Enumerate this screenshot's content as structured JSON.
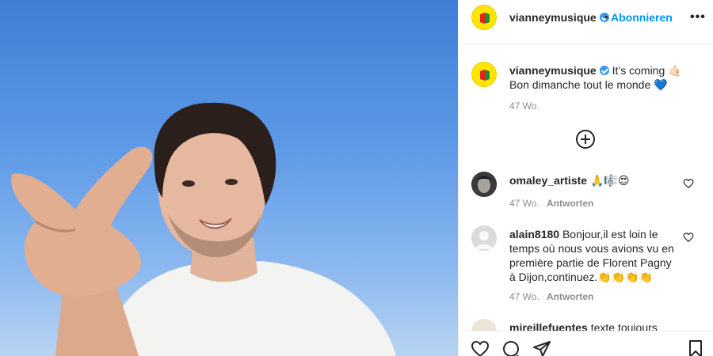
{
  "post": {
    "author": "vianneymusique",
    "follow_label": "Abonnieren",
    "separator": "•",
    "more_label": "•••",
    "caption_line1": "It’s coming 🤙🏻",
    "caption_line2": "Bon dimanche tout le monde 💙",
    "caption_time": "47 Wo."
  },
  "comments": [
    {
      "user": "omaley_artiste",
      "text": "🙏🎼😍",
      "time": "47 Wo.",
      "reply_label": "Antworten"
    },
    {
      "user": "alain8180",
      "text": "Bonjour,il est loin le temps où nous vous avions vu en première partie de Florent Pagny à Dijon,continuez.👏👏👏👏",
      "time": "47 Wo.",
      "reply_label": "Antworten"
    },
    {
      "user": "mireillefuentes",
      "text": "texte toujours"
    }
  ],
  "icons": {
    "like": "heart-icon",
    "comment": "comment-icon",
    "share": "paper-plane-icon",
    "save": "bookmark-icon",
    "load_more": "plus-circle-icon"
  },
  "colors": {
    "accent": "#0095f6",
    "verified": "#3897f0",
    "avatar_bg": "#ffe500",
    "sky": "#5b98e6"
  }
}
